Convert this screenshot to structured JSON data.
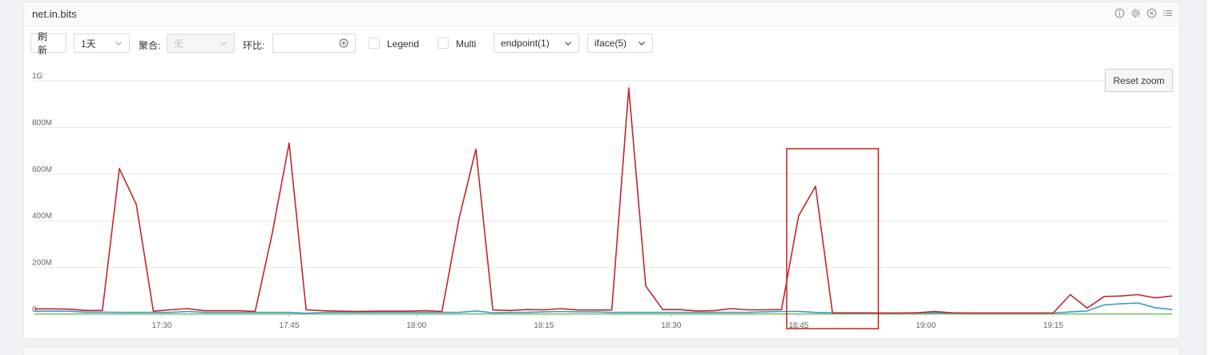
{
  "panel": {
    "title": "net.in.bits"
  },
  "toolbar": {
    "refresh_label": "刷 新",
    "range_value": "1天",
    "aggregate_label": "聚合:",
    "aggregate_value": "无",
    "compare_label": "环比:",
    "compare_value": "",
    "legend_label": "Legend",
    "multi_label": "Multi",
    "endpoint_value": "endpoint(1)",
    "iface_value": "iface(5)"
  },
  "reset_zoom_label": "Reset zoom",
  "colors": {
    "series_red": "#c0272d",
    "series_blue": "#3d9ad1",
    "series_green": "#7cc36b",
    "highlight_box": "#d12a2a"
  },
  "chart_data": {
    "type": "line",
    "y_ticks": [
      "0",
      "200M",
      "400M",
      "600M",
      "800M",
      "1G"
    ],
    "y_tick_values": [
      0,
      200,
      400,
      600,
      800,
      1000
    ],
    "ylim": [
      0,
      1000
    ],
    "x_ticks": [
      "17:30",
      "17:45",
      "18:00",
      "18:15",
      "18:30",
      "18:45",
      "19:00",
      "19:15"
    ],
    "x_tick_minutes": [
      1050,
      1065,
      1080,
      1095,
      1110,
      1125,
      1140,
      1155
    ],
    "xlim": [
      1035,
      1169
    ],
    "grid": true,
    "series": [
      {
        "color": "#c0272d",
        "x": [
          1035,
          1037,
          1039,
          1041,
          1043,
          1045,
          1047,
          1049,
          1051,
          1053,
          1055,
          1057,
          1059,
          1061,
          1063,
          1065,
          1067,
          1069,
          1071,
          1073,
          1075,
          1077,
          1079,
          1081,
          1083,
          1085,
          1087,
          1089,
          1091,
          1093,
          1095,
          1097,
          1099,
          1101,
          1103,
          1105,
          1107,
          1109,
          1111,
          1113,
          1115,
          1117,
          1119,
          1121,
          1123,
          1125,
          1127,
          1129,
          1131,
          1133,
          1135,
          1137,
          1139,
          1141,
          1143,
          1145,
          1147,
          1149,
          1151,
          1153,
          1155,
          1157,
          1159,
          1161,
          1163,
          1165,
          1167,
          1169
        ],
        "y": [
          23,
          23,
          22,
          16,
          16,
          624,
          470,
          13,
          19,
          24,
          15,
          15,
          15,
          12,
          345,
          733,
          19,
          15,
          13,
          12,
          13,
          13,
          13,
          15,
          12,
          409,
          707,
          18,
          16,
          20,
          19,
          24,
          18,
          18,
          18,
          969,
          121,
          20,
          20,
          14,
          15,
          24,
          19,
          19,
          20,
          421,
          548,
          5,
          5,
          5,
          5,
          5,
          6,
          12,
          6,
          5,
          5,
          5,
          5,
          5,
          5,
          84,
          26,
          76,
          78,
          84,
          70,
          78
        ]
      },
      {
        "color": "#3d9ad1",
        "x": [
          1035,
          1037,
          1039,
          1041,
          1043,
          1045,
          1047,
          1049,
          1051,
          1053,
          1055,
          1057,
          1059,
          1061,
          1063,
          1065,
          1067,
          1069,
          1071,
          1073,
          1075,
          1077,
          1079,
          1081,
          1083,
          1085,
          1087,
          1089,
          1091,
          1093,
          1095,
          1097,
          1099,
          1101,
          1103,
          1105,
          1107,
          1109,
          1111,
          1113,
          1115,
          1117,
          1119,
          1121,
          1123,
          1125,
          1127,
          1129,
          1131,
          1133,
          1135,
          1137,
          1139,
          1141,
          1143,
          1145,
          1147,
          1149,
          1151,
          1153,
          1155,
          1157,
          1159,
          1161,
          1163,
          1165,
          1167,
          1169
        ],
        "y": [
          13,
          13,
          13,
          9,
          9,
          8,
          8,
          8,
          8,
          12,
          8,
          8,
          8,
          8,
          8,
          8,
          4,
          8,
          8,
          8,
          8,
          8,
          8,
          8,
          8,
          8,
          14,
          6,
          8,
          8,
          10,
          12,
          10,
          10,
          8,
          8,
          8,
          8,
          8,
          8,
          8,
          8,
          8,
          10,
          12,
          12,
          8,
          6,
          6,
          6,
          5,
          5,
          5,
          6,
          5,
          5,
          5,
          5,
          5,
          5,
          5,
          10,
          14,
          40,
          45,
          48,
          28,
          20
        ]
      },
      {
        "color": "#7cc36b",
        "x": [
          1035,
          1169
        ],
        "y": [
          1,
          1
        ]
      }
    ]
  }
}
